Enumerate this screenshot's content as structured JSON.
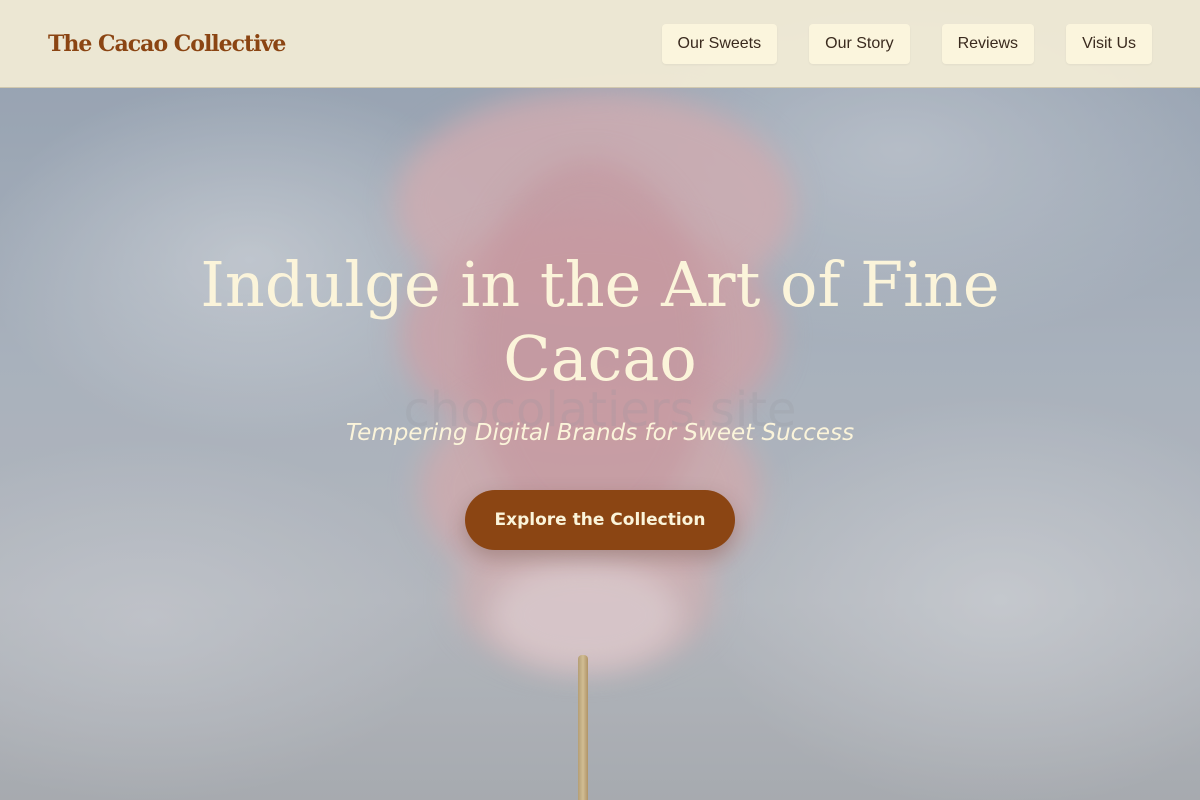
{
  "header": {
    "brand": "The Cacao Collective",
    "nav": [
      {
        "label": "Our Sweets"
      },
      {
        "label": "Our Story"
      },
      {
        "label": "Reviews"
      },
      {
        "label": "Visit Us"
      }
    ]
  },
  "hero": {
    "headline": "Indulge in the Art of Fine Cacao",
    "watermark": "chocolatiers.site",
    "tagline": "Tempering Digital Brands for Sweet Success",
    "cta_label": "Explore the Collection"
  },
  "colors": {
    "brand": "#8b4513",
    "cream": "#fbf4da",
    "nav_bg": "#f3edd6"
  }
}
